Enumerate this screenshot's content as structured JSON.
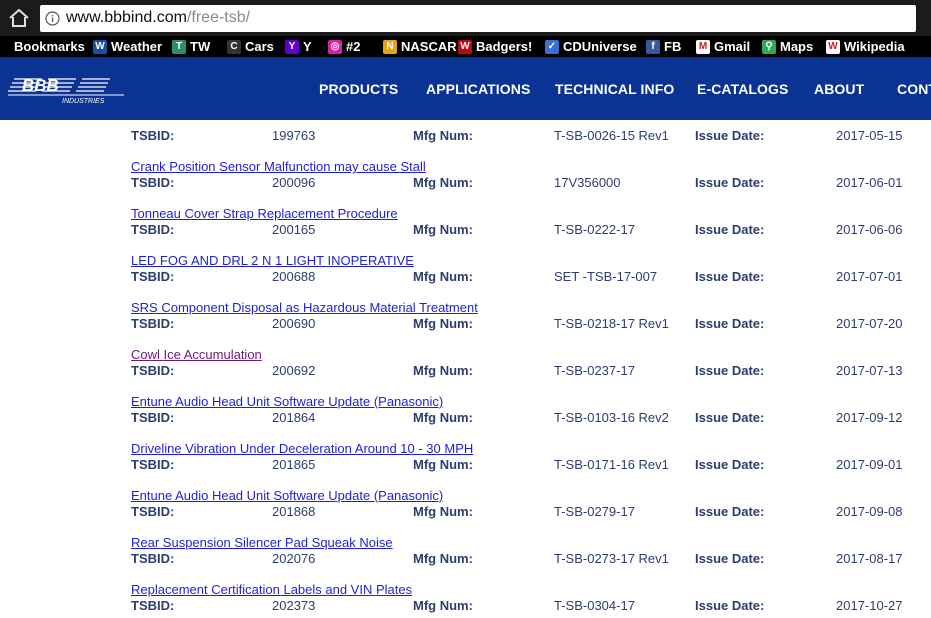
{
  "browser": {
    "url_host": "www.bbbind.com",
    "url_path": "/free-tsb/",
    "bookmarks": [
      {
        "label": "Bookmarks",
        "icon": "none",
        "color": ""
      },
      {
        "label": "Weather",
        "icon": "weather-channel-icon",
        "color": "#1a4fa0"
      },
      {
        "label": "TW",
        "icon": "tw-icon",
        "color": "#2a8f6a"
      },
      {
        "label": "Cars",
        "icon": "c-icon",
        "color": "#333333"
      },
      {
        "label": "Y",
        "icon": "yahoo-icon",
        "color": "#5f01d1"
      },
      {
        "label": "#2",
        "icon": "instagram-icon",
        "color": "#d6249f"
      },
      {
        "label": "NASCAR",
        "icon": "nascar-icon",
        "color": "#e8a317"
      },
      {
        "label": "Badgers!",
        "icon": "wisconsin-icon",
        "color": "#c5050c"
      },
      {
        "label": "CDUniverse",
        "icon": "cdu-icon",
        "color": "#3a6fd8"
      },
      {
        "label": "FB",
        "icon": "facebook-icon",
        "color": "#3b5998"
      },
      {
        "label": "Gmail",
        "icon": "gmail-icon",
        "color": "#ffffff"
      },
      {
        "label": "Maps",
        "icon": "maps-icon",
        "color": "#34a853"
      },
      {
        "label": "Wikipedia",
        "icon": "wikipedia-icon",
        "color": "#ffffff"
      }
    ]
  },
  "header": {
    "logo_text": "BBB",
    "logo_sub": "INDUSTRIES",
    "nav": [
      "PRODUCTS",
      "APPLICATIONS",
      "TECHNICAL INFO",
      "E-CATALOGS",
      "ABOUT",
      "CONT"
    ]
  },
  "labels": {
    "tsbid": "TSBID:",
    "mfg": "Mfg Num:",
    "issue": "Issue Date:"
  },
  "entries": [
    {
      "title": "",
      "tsbid": "199763",
      "mfg": "T-SB-0026-15 Rev1",
      "date": "2017-05-15",
      "visited": false
    },
    {
      "title": "Crank Position Sensor Malfunction may cause Stall",
      "tsbid": "200096",
      "mfg": "17V356000",
      "date": "2017-06-01",
      "visited": false
    },
    {
      "title": "Tonneau Cover Strap Replacement Procedure",
      "tsbid": "200165",
      "mfg": "T-SB-0222-17",
      "date": "2017-06-06",
      "visited": false
    },
    {
      "title": "LED FOG AND DRL 2 N 1 LIGHT INOPERATIVE",
      "tsbid": "200688",
      "mfg": "SET -TSB-17-007",
      "date": "2017-07-01",
      "visited": false
    },
    {
      "title": "SRS Component Disposal as Hazardous Material Treatment",
      "tsbid": "200690",
      "mfg": "T-SB-0218-17 Rev1",
      "date": "2017-07-20",
      "visited": false
    },
    {
      "title": "Cowl Ice Accumulation",
      "tsbid": "200692",
      "mfg": "T-SB-0237-17",
      "date": "2017-07-13",
      "visited": true
    },
    {
      "title": "Entune Audio Head Unit Software Update (Panasonic)",
      "tsbid": "201864",
      "mfg": "T-SB-0103-16 Rev2",
      "date": "2017-09-12",
      "visited": false
    },
    {
      "title": "Driveline Vibration Under Deceleration Around 10 - 30 MPH",
      "tsbid": "201865",
      "mfg": "T-SB-0171-16 Rev1",
      "date": "2017-09-01",
      "visited": false
    },
    {
      "title": "Entune Audio Head Unit Software Update (Panasonic)",
      "tsbid": "201868",
      "mfg": "T-SB-0279-17",
      "date": "2017-09-08",
      "visited": false
    },
    {
      "title": "Rear Suspension Silencer Pad Squeak Noise",
      "tsbid": "202076",
      "mfg": "T-SB-0273-17 Rev1",
      "date": "2017-08-17",
      "visited": false
    },
    {
      "title": "Replacement Certification Labels and VIN Plates",
      "tsbid": "202373",
      "mfg": "T-SB-0304-17",
      "date": "2017-10-27",
      "visited": false
    }
  ]
}
